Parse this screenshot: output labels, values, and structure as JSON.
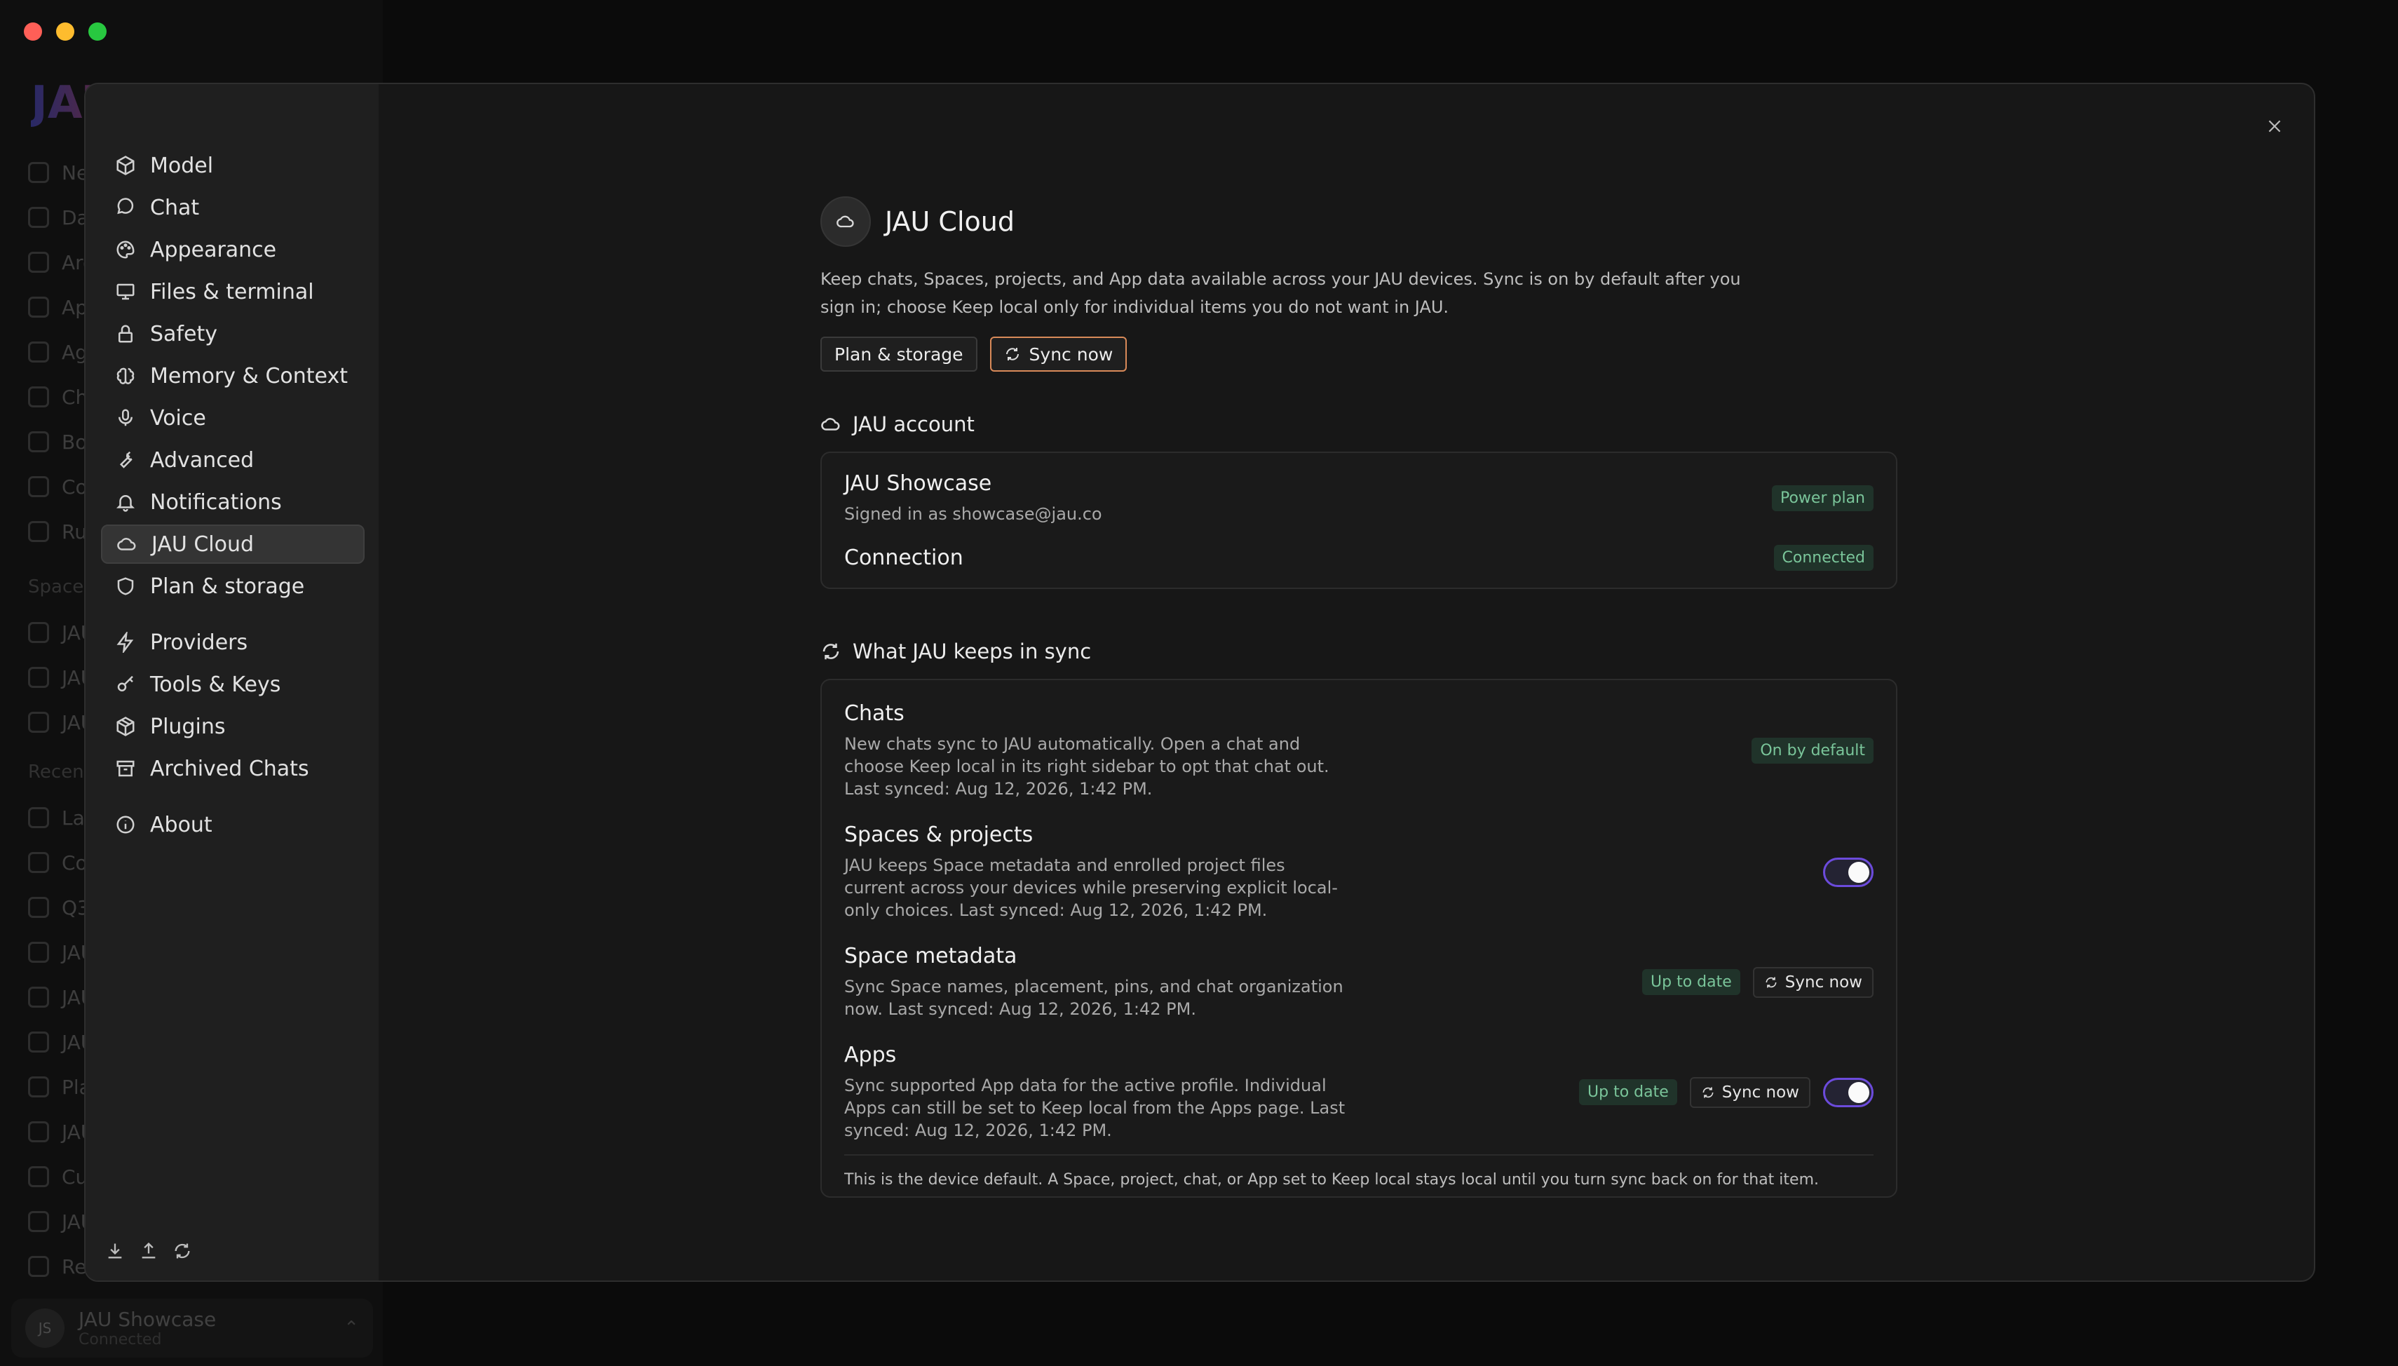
{
  "background": {
    "items": [
      "New chat",
      "Dashboard",
      "Archive",
      "Apps",
      "Agents",
      "Chats",
      "Boards",
      "Connectors",
      "Runs"
    ],
    "section_spaces": "Spaces",
    "spaces": [
      "JAU",
      "JAU",
      "JAU"
    ],
    "section_recent": "Recent",
    "recent": [
      "Lau",
      "Co",
      "Q3",
      "JAU",
      "JAU",
      "JAU",
      "Pla",
      "JAU",
      "Cus",
      "JAU",
      "Rel"
    ],
    "user": {
      "initials": "JS",
      "name": "JAU Showcase",
      "status": "Connected"
    }
  },
  "nav": {
    "items": [
      {
        "label": "Model",
        "icon": "cube-icon"
      },
      {
        "label": "Chat",
        "icon": "chat-bubble-icon"
      },
      {
        "label": "Appearance",
        "icon": "palette-icon"
      },
      {
        "label": "Files & terminal",
        "icon": "monitor-icon"
      },
      {
        "label": "Safety",
        "icon": "lock-icon"
      },
      {
        "label": "Memory & Context",
        "icon": "brain-icon"
      },
      {
        "label": "Voice",
        "icon": "microphone-icon"
      },
      {
        "label": "Advanced",
        "icon": "wrench-icon"
      },
      {
        "label": "Notifications",
        "icon": "bell-icon"
      },
      {
        "label": "JAU Cloud",
        "icon": "cloud-icon"
      },
      {
        "label": "Plan & storage",
        "icon": "shield-icon"
      },
      {
        "label": "Providers",
        "icon": "bolt-icon"
      },
      {
        "label": "Tools & Keys",
        "icon": "key-icon"
      },
      {
        "label": "Plugins",
        "icon": "package-icon"
      },
      {
        "label": "Archived Chats",
        "icon": "archive-icon"
      },
      {
        "label": "About",
        "icon": "info-icon"
      }
    ],
    "active": "JAU Cloud"
  },
  "page": {
    "title": "JAU Cloud",
    "description": "Keep chats, Spaces, projects, and App data available across your JAU devices. Sync is on by default after you sign in; choose Keep local only for individual items you do not want in JAU.",
    "plan_button": "Plan & storage",
    "sync_button": "Sync now"
  },
  "account": {
    "section_title": "JAU account",
    "name": "JAU Showcase",
    "signed_in": "Signed in as showcase@jau.co",
    "plan_badge": "Power plan",
    "connection_label": "Connection",
    "connection_badge": "Connected"
  },
  "sync": {
    "section_title": "What JAU keeps in sync",
    "items": [
      {
        "title": "Chats",
        "desc": "New chats sync to JAU automatically. Open a chat and choose Keep local in its right sidebar to opt that chat out. Last synced: Aug 12, 2026, 1:42 PM.",
        "badge": "On by default"
      },
      {
        "title": "Spaces & projects",
        "desc": "JAU keeps Space metadata and enrolled project files current across your devices while preserving explicit local-only choices. Last synced: Aug 12, 2026, 1:42 PM.",
        "toggle": true
      },
      {
        "title": "Space metadata",
        "desc": "Sync Space names, placement, pins, and chat organization now. Last synced: Aug 12, 2026, 1:42 PM.",
        "badge": "Up to date",
        "button": "Sync now"
      },
      {
        "title": "Apps",
        "desc": "Sync supported App data for the active profile. Individual Apps can still be set to Keep local from the Apps page. Last synced: Aug 12, 2026, 1:42 PM.",
        "badge": "Up to date",
        "button": "Sync now",
        "toggle": true
      }
    ],
    "footnote": "This is the device default. A Space, project, chat, or App set to Keep local stays local until you turn sync back on for that item."
  },
  "colors": {
    "accent_toggle": "#6c4bdc",
    "badge_text": "#7ac59a",
    "sync_button_border": "#d98a59"
  }
}
